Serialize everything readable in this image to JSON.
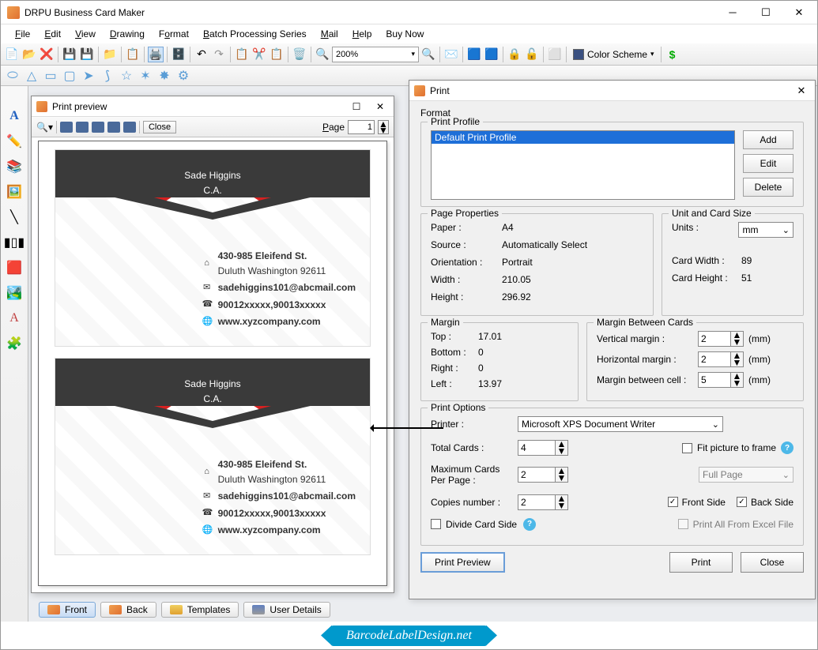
{
  "app": {
    "title": "DRPU Business Card Maker"
  },
  "menu": {
    "file": "File",
    "edit": "Edit",
    "view": "View",
    "drawing": "Drawing",
    "format": "Format",
    "batch": "Batch Processing Series",
    "mail": "Mail",
    "help": "Help",
    "buy": "Buy Now"
  },
  "toolbar": {
    "zoom": "200%",
    "colorscheme": "Color Scheme"
  },
  "preview": {
    "title": "Print preview",
    "close": "Close",
    "page_label": "Page",
    "page": "1",
    "card": {
      "name": "Sade Higgins",
      "sub": "C.A.",
      "addr1": "430-985 Eleifend St.",
      "addr2": "Duluth Washington 92611",
      "email": "sadehiggins101@abcmail.com",
      "phone": "90012xxxxx,90013xxxxx",
      "web": "www.xyzcompany.com"
    }
  },
  "print": {
    "title": "Print",
    "format_label": "Format",
    "profile_label": "Print Profile",
    "profile_sel": "Default Print Profile",
    "btn_add": "Add",
    "btn_edit": "Edit",
    "btn_delete": "Delete",
    "pageprops": {
      "title": "Page Properties",
      "paper_l": "Paper :",
      "paper": "A4",
      "source_l": "Source :",
      "source": "Automatically Select",
      "orient_l": "Orientation :",
      "orient": "Portrait",
      "width_l": "Width :",
      "width": "210.05",
      "height_l": "Height :",
      "height": "296.92"
    },
    "unit": {
      "title": "Unit and Card Size",
      "units_l": "Units :",
      "units": "mm",
      "cw_l": "Card Width :",
      "cw": "89",
      "ch_l": "Card Height :",
      "ch": "51"
    },
    "margin": {
      "title": "Margin",
      "top_l": "Top :",
      "top": "17.01",
      "bottom_l": "Bottom :",
      "bottom": "0",
      "right_l": "Right :",
      "right": "0",
      "left_l": "Left :",
      "left": "13.97"
    },
    "mbc": {
      "title": "Margin Between Cards",
      "vm_l": "Vertical margin :",
      "vm": "2",
      "hm_l": "Horizontal margin :",
      "hm": "2",
      "mc_l": "Margin between cell :",
      "mc": "5",
      "mm": "(mm)"
    },
    "opts": {
      "title": "Print Options",
      "printer_l": "Printer :",
      "printer": "Microsoft XPS Document Writer",
      "tc_l": "Total Cards :",
      "tc": "4",
      "mp_l": "Maximum Cards Per Page :",
      "mp": "2",
      "cn_l": "Copies number :",
      "cn": "2",
      "divide": "Divide Card Side",
      "fit": "Fit picture to frame",
      "fullpage": "Full Page",
      "front": "Front Side",
      "back": "Back Side",
      "excel": "Print All From Excel File"
    },
    "btn_preview": "Print Preview",
    "btn_print": "Print",
    "btn_close": "Close"
  },
  "tabs": {
    "front": "Front",
    "back": "Back",
    "templates": "Templates",
    "user": "User Details"
  },
  "footer": {
    "link": "BarcodeLabelDesign.net"
  }
}
